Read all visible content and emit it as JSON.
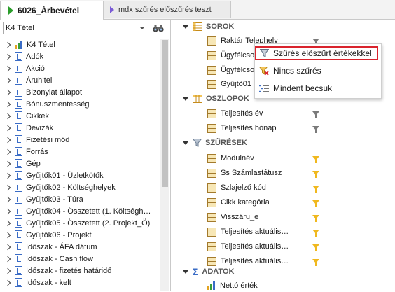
{
  "tabs": [
    {
      "label": "6026_Árbevétel",
      "active": true
    },
    {
      "label": "mdx szűrés előszűrés teszt",
      "active": false
    }
  ],
  "left_panel": {
    "selector_value": "K4 Tétel",
    "tree": [
      {
        "label": "K4 Tétel",
        "icon": "measure-bars-icon"
      },
      {
        "label": "Adók",
        "icon": "dimension-icon"
      },
      {
        "label": "Akció",
        "icon": "dimension-icon"
      },
      {
        "label": "Áruhitel",
        "icon": "dimension-icon"
      },
      {
        "label": "Bizonylat állapot",
        "icon": "dimension-icon"
      },
      {
        "label": "Bónuszmentesség",
        "icon": "dimension-icon"
      },
      {
        "label": "Cikkek",
        "icon": "dimension-icon"
      },
      {
        "label": "Devizák",
        "icon": "dimension-icon"
      },
      {
        "label": "Fizetési mód",
        "icon": "dimension-icon"
      },
      {
        "label": "Forrás",
        "icon": "dimension-icon"
      },
      {
        "label": "Gép",
        "icon": "dimension-icon"
      },
      {
        "label": "Gyűjtők01 - Üzletkötők",
        "icon": "dimension-icon"
      },
      {
        "label": "Gyűjtők02 - Költséghelyek",
        "icon": "dimension-icon"
      },
      {
        "label": "Gyűjtők03 - Túra",
        "icon": "dimension-icon"
      },
      {
        "label": "Gyűjtők04 - Összetett (1. Költségh…",
        "icon": "dimension-icon"
      },
      {
        "label": "Gyűjtők05 - Összetett (2. Projekt_Ö)",
        "icon": "dimension-icon"
      },
      {
        "label": "Gyűjtők06 - Projekt",
        "icon": "dimension-icon"
      },
      {
        "label": "Időszak - ÁFA dátum",
        "icon": "dimension-icon"
      },
      {
        "label": "Időszak - Cash flow",
        "icon": "dimension-icon"
      },
      {
        "label": "Időszak - fizetés határidő",
        "icon": "dimension-icon"
      },
      {
        "label": "Időszak - kelt",
        "icon": "dimension-icon"
      }
    ]
  },
  "right_panel": {
    "sections": {
      "rows": {
        "title": "SOROK",
        "fields": [
          {
            "label": "Raktár Telephely",
            "filter": "gray"
          },
          {
            "label": "Ügyfélcsop…",
            "filter": "gray"
          },
          {
            "label": "Ügyfélcsop…",
            "filter": "gray"
          },
          {
            "label": "Gyűjtő01 - …",
            "filter": "gray"
          }
        ]
      },
      "columns": {
        "title": "OSZLOPOK",
        "fields": [
          {
            "label": "Teljesítés év",
            "filter": "gray"
          },
          {
            "label": "Teljesítés hónap",
            "filter": "gray"
          }
        ]
      },
      "filters": {
        "title": "SZŰRÉSEK",
        "fields": [
          {
            "label": "Modulnév",
            "filter": "yellow"
          },
          {
            "label": "Ss Számlastátusz",
            "filter": "yellow"
          },
          {
            "label": "Szlajelző kód",
            "filter": "yellow"
          },
          {
            "label": "Cikk kategória",
            "filter": "yellow"
          },
          {
            "label": "Visszáru_e",
            "filter": "yellow"
          },
          {
            "label": "Teljesítés aktuális…",
            "filter": "yellow"
          },
          {
            "label": "Teljesítés aktuális…",
            "filter": "yellow"
          },
          {
            "label": "Teljesítés aktuális…",
            "filter": "yellow"
          }
        ]
      },
      "data": {
        "title": "ADATOK",
        "fields": [
          {
            "label": "Nettó érték"
          }
        ]
      }
    }
  },
  "context_menu": {
    "items": [
      {
        "label": "Szűrés előszűrt értékekkel",
        "icon": "filter-icon",
        "highlighted": true
      },
      {
        "label": "Nincs szűrés",
        "icon": "clear-filter-icon"
      },
      {
        "label": "Mindent becsuk",
        "icon": "collapse-all-icon"
      }
    ]
  },
  "colors": {
    "highlight_border": "#d9232d",
    "active_filter": "#f0b81e",
    "inactive_filter": "#7a7a7a",
    "dimension_icon": "#3a6cc6"
  }
}
